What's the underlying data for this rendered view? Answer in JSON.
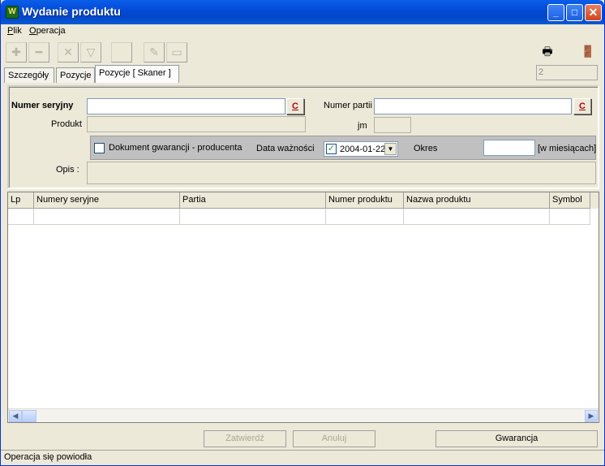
{
  "window": {
    "title": "Wydanie produktu",
    "title_icon": "app-icon"
  },
  "menu": [
    {
      "label_u": "P",
      "label_rest": "lik"
    },
    {
      "label_u": "O",
      "label_rest": "peracja"
    }
  ],
  "tabs": [
    {
      "label": "Szczegóły",
      "active": false
    },
    {
      "label": "Pozycje",
      "active": false
    },
    {
      "label": "Pozycje [ Skaner ]",
      "active": true
    }
  ],
  "counter_value": "2",
  "form": {
    "serial_label": "Numer seryjny",
    "serial_value": "",
    "product_label": "Produkt",
    "product_value": "",
    "batch_label": "Numer partii",
    "batch_value": "",
    "unit_label": "jm",
    "unit_value": "",
    "clear_button_label": "C",
    "warranty_doc_label": "Dokument gwarancji - producenta",
    "expiry_label": "Data ważności",
    "expiry_value": "2004-01-22",
    "period_label": "Okres",
    "period_value": "",
    "period_unit": "[w miesiącach]",
    "description_label": "Opis :",
    "description_value": ""
  },
  "grid": {
    "columns": [
      "Lp",
      "Numery seryjne",
      "Partia",
      "Numer produktu",
      "Nazwa produktu",
      "Symbol"
    ]
  },
  "buttons": {
    "confirm": "Zatwierdź",
    "cancel": "Anuluj",
    "warranty": "Gwarancja"
  },
  "status": "Operacja się powiodła"
}
